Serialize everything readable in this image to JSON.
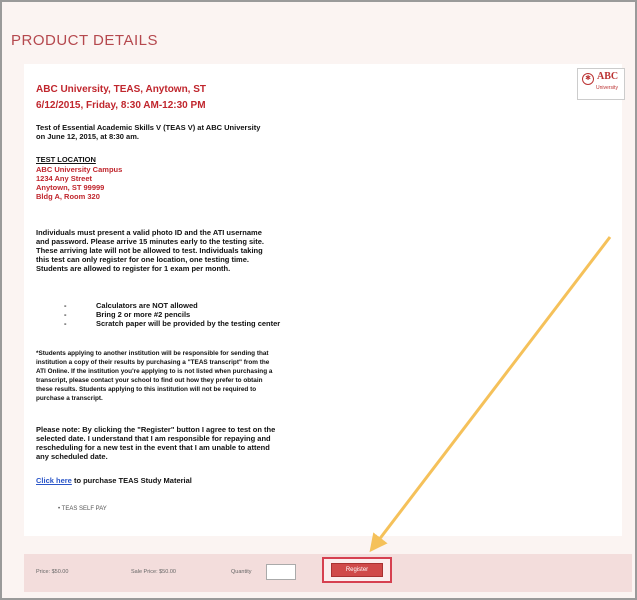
{
  "page": {
    "heading": "PRODUCT DETAILS"
  },
  "logo": {
    "text": "ABC",
    "subtext": "University"
  },
  "event": {
    "title": "ABC University, TEAS, Anytown, ST",
    "datetime": "6/12/2015, Friday, 8:30 AM-12:30 PM",
    "intro_line1": "Test of Essential Academic Skills V (TEAS V) at ABC University",
    "intro_line2": "on June 12, 2015, at 8:30 am."
  },
  "location": {
    "heading": "TEST LOCATION",
    "lines": [
      "ABC University Campus",
      "1234 Any Street",
      "Anytown, ST 99999",
      "Bldg A, Room 320"
    ]
  },
  "requirements": [
    "Individuals must present a valid photo ID and the ATI username",
    "and password. Please arrive 15 minutes early to the testing site.",
    "These arriving late will not be allowed to test. Individuals taking",
    "this test can only register for one location, one testing time.",
    "Students are allowed to register for 1 exam per month."
  ],
  "bullets": [
    "Calculators are NOT allowed",
    "Bring 2 or more #2 pencils",
    "Scratch paper will be provided by the testing center"
  ],
  "transcript_note": [
    "*Students applying to another institution will be responsible for sending that",
    "institution a copy of their results by purchasing a \"TEAS transcript\" from the",
    "ATI Online. If the institution you're applying to is not listed when purchasing a",
    "transcript, please contact your school to find out how they prefer to obtain",
    "these results. Students applying to this institution will not be required to",
    "purchase a transcript."
  ],
  "register_note": [
    "Please note: By clicking the \"Register\" button I agree to test on the",
    "selected date. I understand that I am responsible for repaying and",
    "rescheduling for a new test in the event that I am unable to attend",
    "any scheduled date."
  ],
  "study": {
    "link": "Click here",
    "rest": " to purchase TEAS Study Material"
  },
  "self_pay": "TEAS SELF PAY",
  "purchase": {
    "price": "Price: $50.00",
    "sale_price": "Sale Price: $50.00",
    "quantity_label": "Quantity",
    "register_label": "Register"
  },
  "colors": {
    "accent": "#c0262d",
    "arrow": "#f5c15a",
    "highlight": "#d64050"
  }
}
